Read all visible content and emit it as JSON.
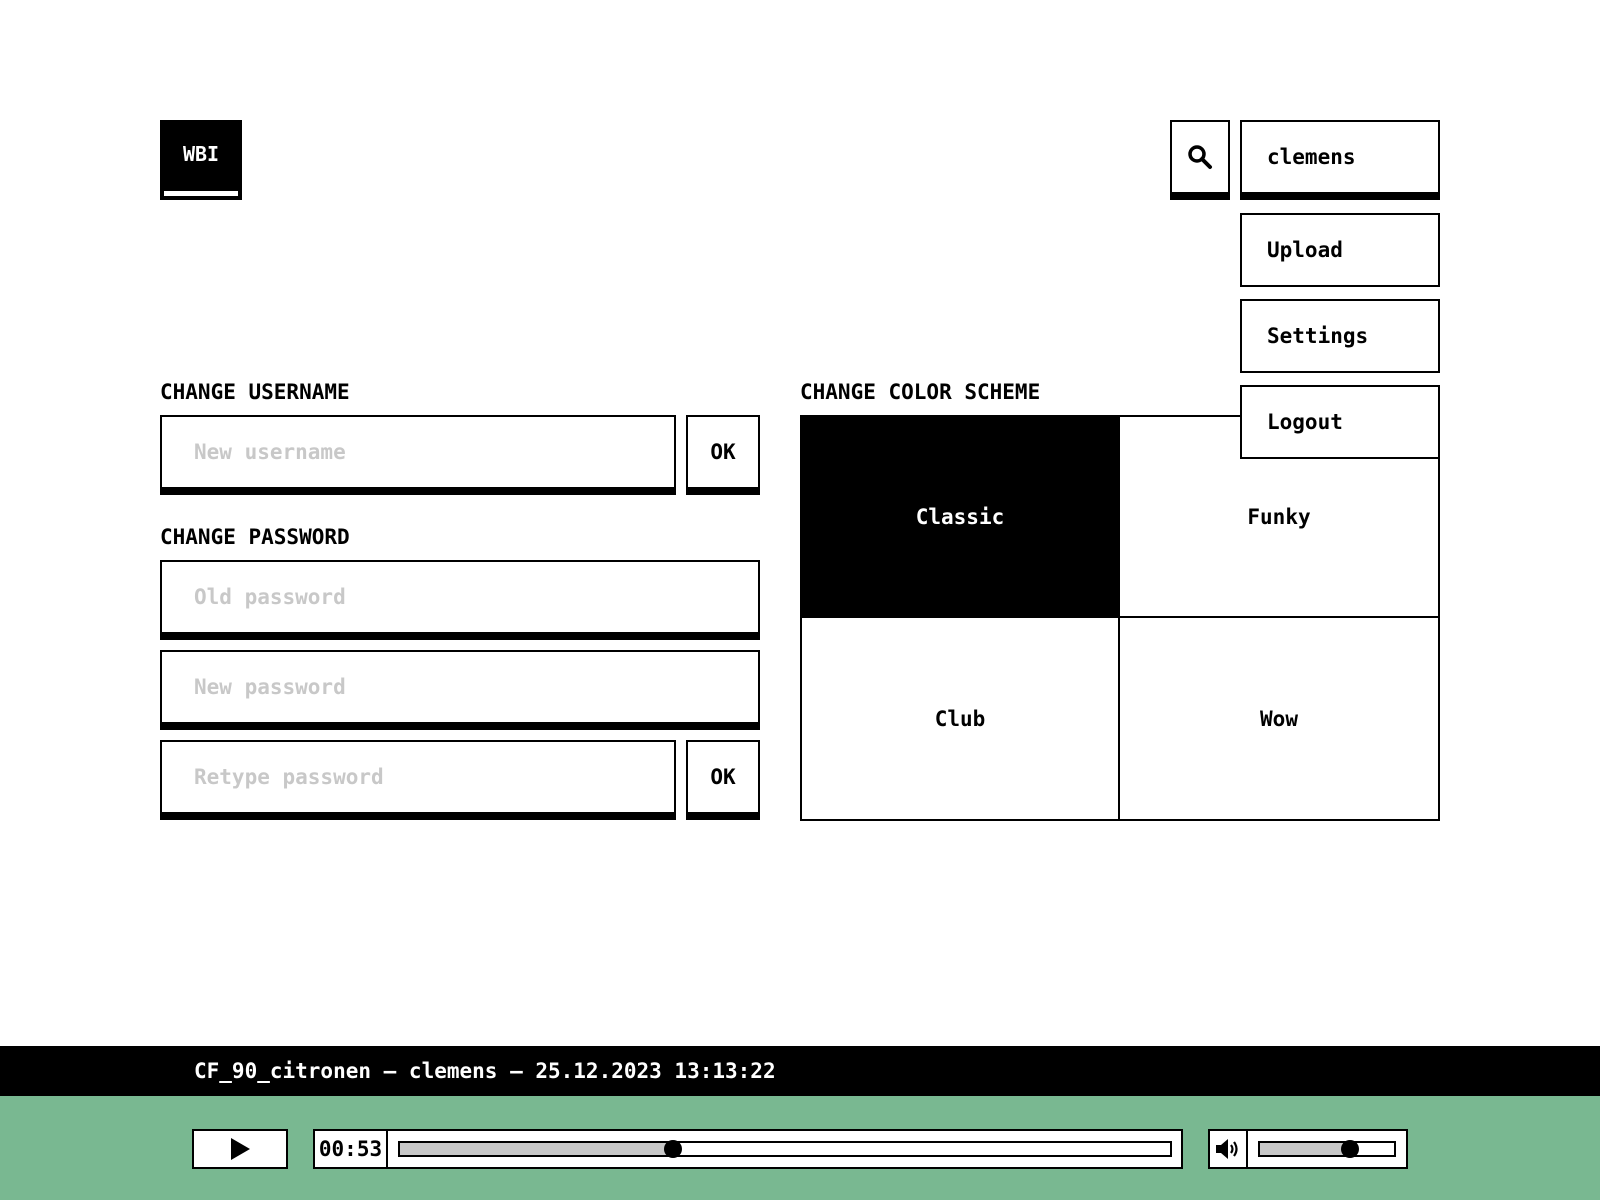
{
  "header": {
    "logo": "WBI",
    "search_icon": "search-icon",
    "username": "clemens"
  },
  "user_menu": {
    "items": [
      {
        "label": "Upload"
      },
      {
        "label": "Settings"
      },
      {
        "label": "Logout"
      }
    ]
  },
  "change_username": {
    "title": "CHANGE USERNAME",
    "input_placeholder": "New username",
    "input_value": "",
    "ok_label": "OK"
  },
  "change_password": {
    "title": "CHANGE PASSWORD",
    "old_placeholder": "Old password",
    "new_placeholder": "New password",
    "retype_placeholder": "Retype password",
    "ok_label": "OK"
  },
  "color_scheme": {
    "title": "CHANGE COLOR SCHEME",
    "options": [
      {
        "label": "Classic",
        "selected": true
      },
      {
        "label": "Funky",
        "selected": false
      },
      {
        "label": "Club",
        "selected": false
      },
      {
        "label": "Wow",
        "selected": false
      }
    ]
  },
  "player": {
    "now_playing": "CF_90_citronen – clemens – 25.12.2023 13:13:22",
    "play_icon": "play-icon",
    "current_time": "00:53",
    "progress_fraction": 0.355,
    "volume_icon": "volume-icon",
    "volume_fraction": 0.67,
    "bar_color": "#79b891"
  }
}
